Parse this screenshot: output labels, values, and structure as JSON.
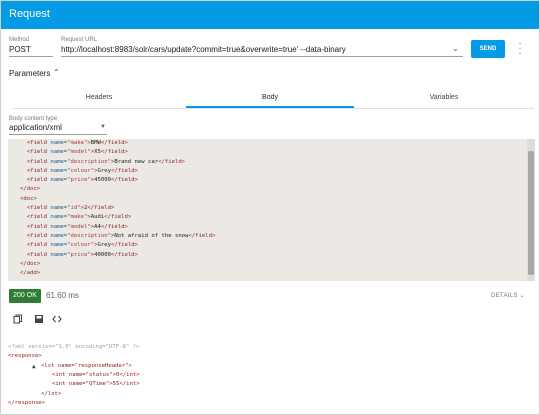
{
  "appbar": {
    "title": "Request"
  },
  "request": {
    "method_label": "Method",
    "method_value": "POST",
    "url_label": "Request URL",
    "url_value": "http://localhost:8983/solr/cars/update?commit=true&overwrite=true' --data-binary",
    "send_label": "SEND"
  },
  "parameters": {
    "title": "Parameters"
  },
  "tabs": [
    {
      "label": "Headers"
    },
    {
      "label": "Body",
      "active": true
    },
    {
      "label": "Variables"
    }
  ],
  "body": {
    "content_type_label": "Body content type",
    "content_type_value": "application/xml"
  },
  "body_code": {
    "lines": [
      {
        "type": "field",
        "name": "make",
        "value": "BMW"
      },
      {
        "type": "field",
        "name": "model",
        "value": "X5"
      },
      {
        "type": "field",
        "name": "description",
        "value": "Brand new car"
      },
      {
        "type": "field",
        "name": "colour",
        "value": "Grey"
      },
      {
        "type": "field",
        "name": "price",
        "value": "45000"
      },
      {
        "type": "close",
        "tag": "doc"
      },
      {
        "type": "open",
        "tag": "doc"
      },
      {
        "type": "field",
        "name": "id",
        "value": "2"
      },
      {
        "type": "field",
        "name": "make",
        "value": "Audi"
      },
      {
        "type": "field",
        "name": "model",
        "value": "A4"
      },
      {
        "type": "field",
        "name": "description",
        "value": "Not afraid of the snow"
      },
      {
        "type": "field",
        "name": "colour",
        "value": "Grey"
      },
      {
        "type": "field",
        "name": "price",
        "value": "40000"
      },
      {
        "type": "close",
        "tag": "doc"
      },
      {
        "type": "close",
        "tag": "add"
      }
    ]
  },
  "response": {
    "status": "200 OK",
    "time": "61.60 ms",
    "details_label": "DETAILS",
    "declaration": "<?xml version=\"1.0\" encoding=\"UTF-8\" ?>",
    "response_open": "<response>",
    "lst_open": "<lst name=\"responseHeader\">",
    "int_status": "<int name=\"status\">0</int>",
    "int_qtime": "<int name=\"QTime\">55</int>",
    "lst_close": "</lst>",
    "response_close": "</response>"
  },
  "icons": {
    "more": "more-vert-icon",
    "chevron": "chevron-down-icon",
    "copy": "copy-icon",
    "save": "save-icon",
    "code": "code-icon"
  },
  "colors": {
    "accent": "#039be5",
    "success": "#2e7d32",
    "code_bg": "#ece9e5"
  }
}
